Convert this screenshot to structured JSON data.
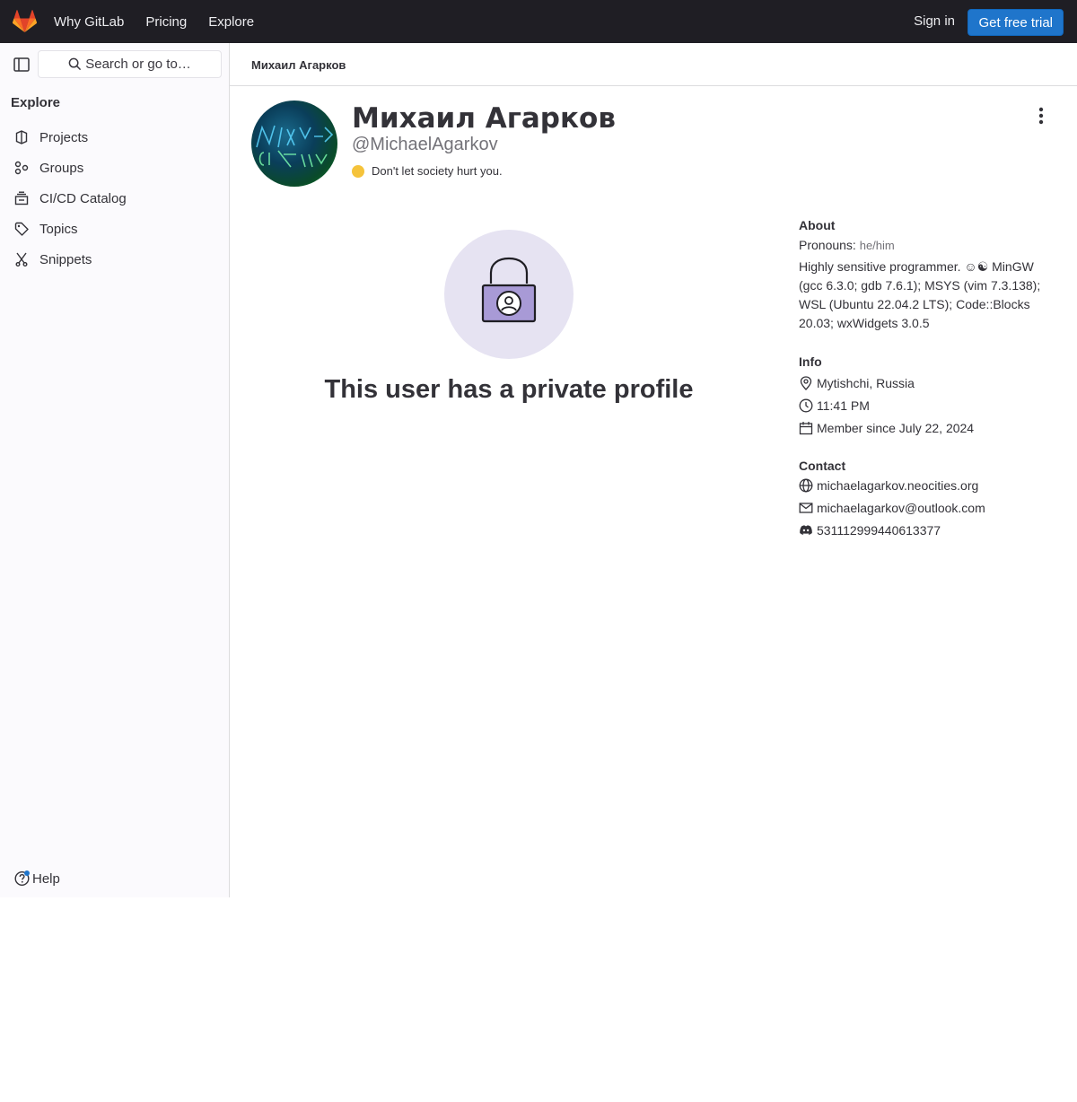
{
  "topbar": {
    "nav": [
      "Why GitLab",
      "Pricing",
      "Explore"
    ],
    "sign_in": "Sign in",
    "trial": "Get free trial"
  },
  "sidebar": {
    "search_placeholder": "Search or go to…",
    "heading": "Explore",
    "items": [
      {
        "label": "Projects",
        "icon": "project-icon"
      },
      {
        "label": "Groups",
        "icon": "group-icon"
      },
      {
        "label": "CI/CD Catalog",
        "icon": "catalog-icon"
      },
      {
        "label": "Topics",
        "icon": "tag-icon"
      },
      {
        "label": "Snippets",
        "icon": "snippet-icon"
      }
    ],
    "help": "Help"
  },
  "breadcrumb": "Михаил Агарков",
  "profile": {
    "name": "Михаил Агарков",
    "handle": "@MichaelAgarkov",
    "status": "Don't let society hurt you.",
    "private_message": "This user has a private profile"
  },
  "about": {
    "heading": "About",
    "pronouns_label": "Pronouns:",
    "pronouns": "he/him",
    "bio_line1": "Highly sensitive programmer. ☺☯ MinGW",
    "bio_line2": "(gcc 6.3.0; gdb 7.6.1); MSYS (vim 7.3.138);",
    "bio_line3": "WSL (Ubuntu 22.04.2 LTS); Code::Blocks",
    "bio_line4": "20.03; wxWidgets 3.0.5"
  },
  "info": {
    "heading": "Info",
    "location": "Mytishchi, Russia",
    "time": "11:41 PM",
    "member_since": "Member since July 22, 2024"
  },
  "contact": {
    "heading": "Contact",
    "website": "michaelagarkov.neocities.org",
    "email": "michaelagarkov@outlook.com",
    "discord": "531112999440613377"
  },
  "colors": {
    "topbar": "#1f1e24",
    "primary_button": "#1f75cb",
    "lock_circle": "#e6e3f2",
    "lock_body": "#a89ad6"
  }
}
